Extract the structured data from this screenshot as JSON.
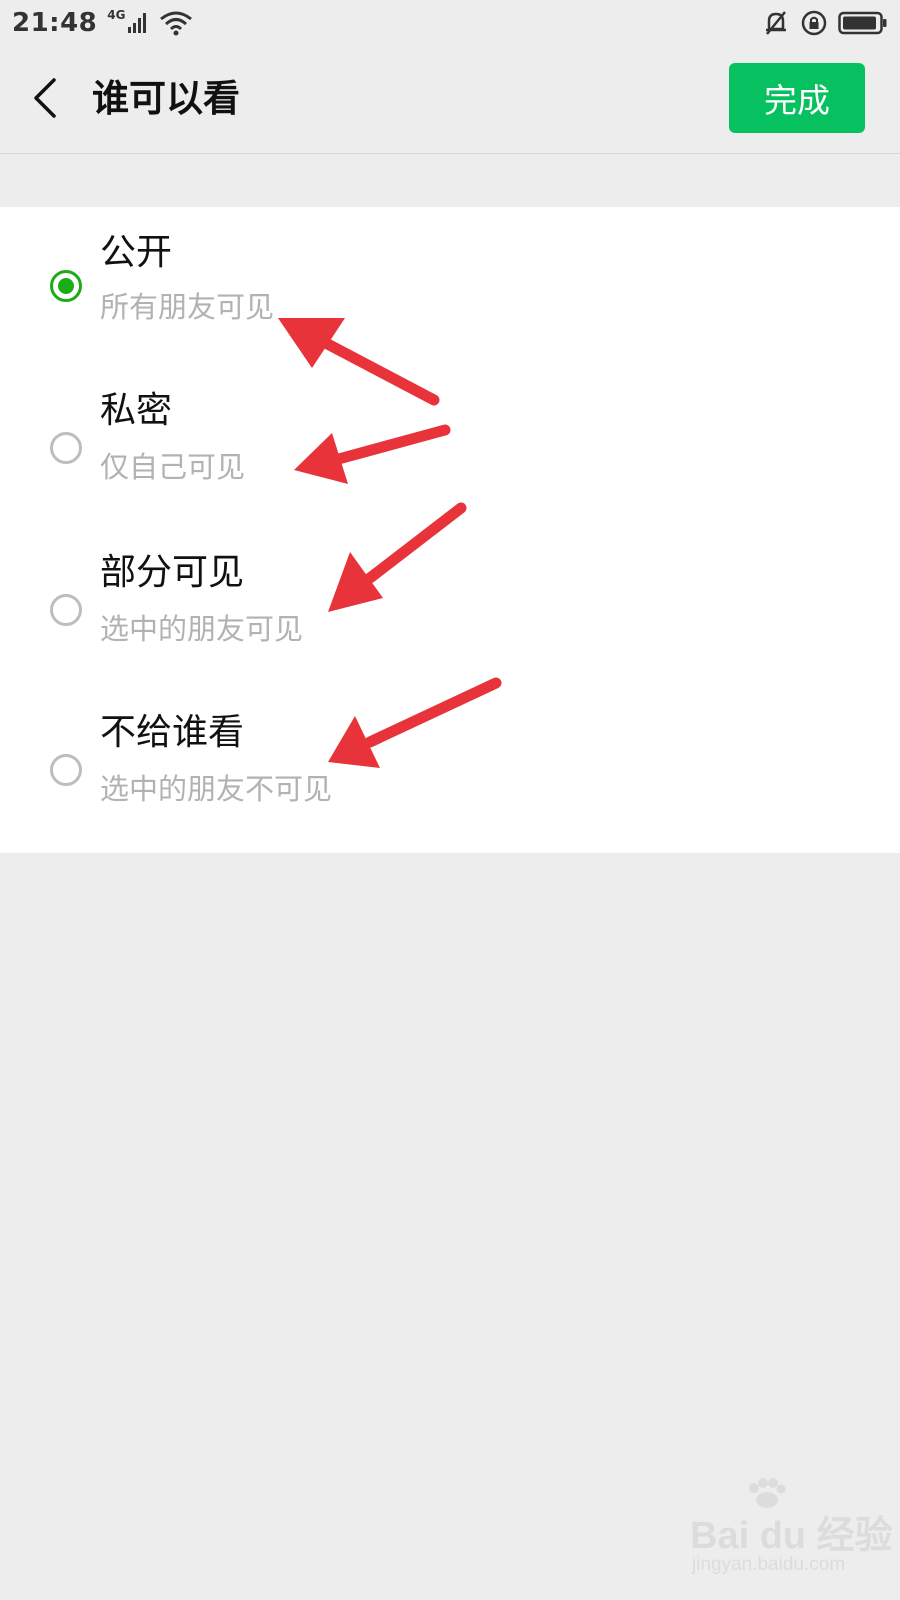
{
  "status_bar": {
    "time": "21:48",
    "network": "4G",
    "icons": [
      "signal-icon",
      "wifi-icon",
      "bell-off-icon",
      "rotation-lock-icon",
      "battery-icon"
    ]
  },
  "nav": {
    "title": "谁可以看",
    "done_label": "完成"
  },
  "options": [
    {
      "title": "公开",
      "desc": "所有朋友可见",
      "selected": true
    },
    {
      "title": "私密",
      "desc": "仅自己可见",
      "selected": false
    },
    {
      "title": "部分可见",
      "desc": "选中的朋友可见",
      "selected": false
    },
    {
      "title": "不给谁看",
      "desc": "选中的朋友不可见",
      "selected": false
    }
  ],
  "colors": {
    "accent": "#07c160",
    "radio_selected": "#1aad19",
    "background": "#ededed",
    "annotation_arrow": "#e8333a"
  },
  "watermark": {
    "brand": "Bai du 经验",
    "url": "jingyan.baidu.com"
  }
}
